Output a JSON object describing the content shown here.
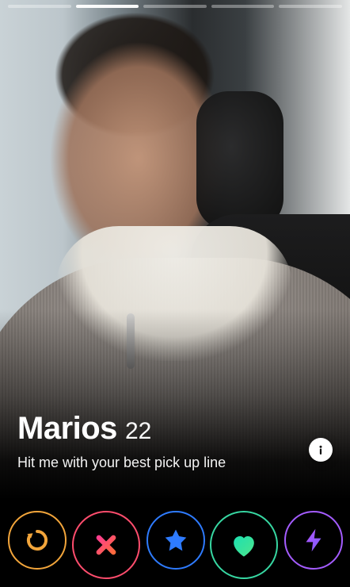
{
  "profile": {
    "name": "Marios",
    "age": "22",
    "bio": "Hit me with your best pick up line"
  },
  "photo": {
    "active_index": 2,
    "count": 5
  },
  "actions": [
    {
      "icon": "rewind-icon",
      "name": "rewind-button",
      "color": "#f2a53b"
    },
    {
      "icon": "close-icon",
      "name": "nope-button",
      "color": "#ff4d6d"
    },
    {
      "icon": "star-icon",
      "name": "super-like-button",
      "color": "#2e7bff"
    },
    {
      "icon": "heart-icon",
      "name": "like-button",
      "color": "#37d7a2"
    },
    {
      "icon": "lightning-icon",
      "name": "boost-button",
      "color": "#a45cff"
    }
  ],
  "icons": {
    "info": "info-icon"
  }
}
